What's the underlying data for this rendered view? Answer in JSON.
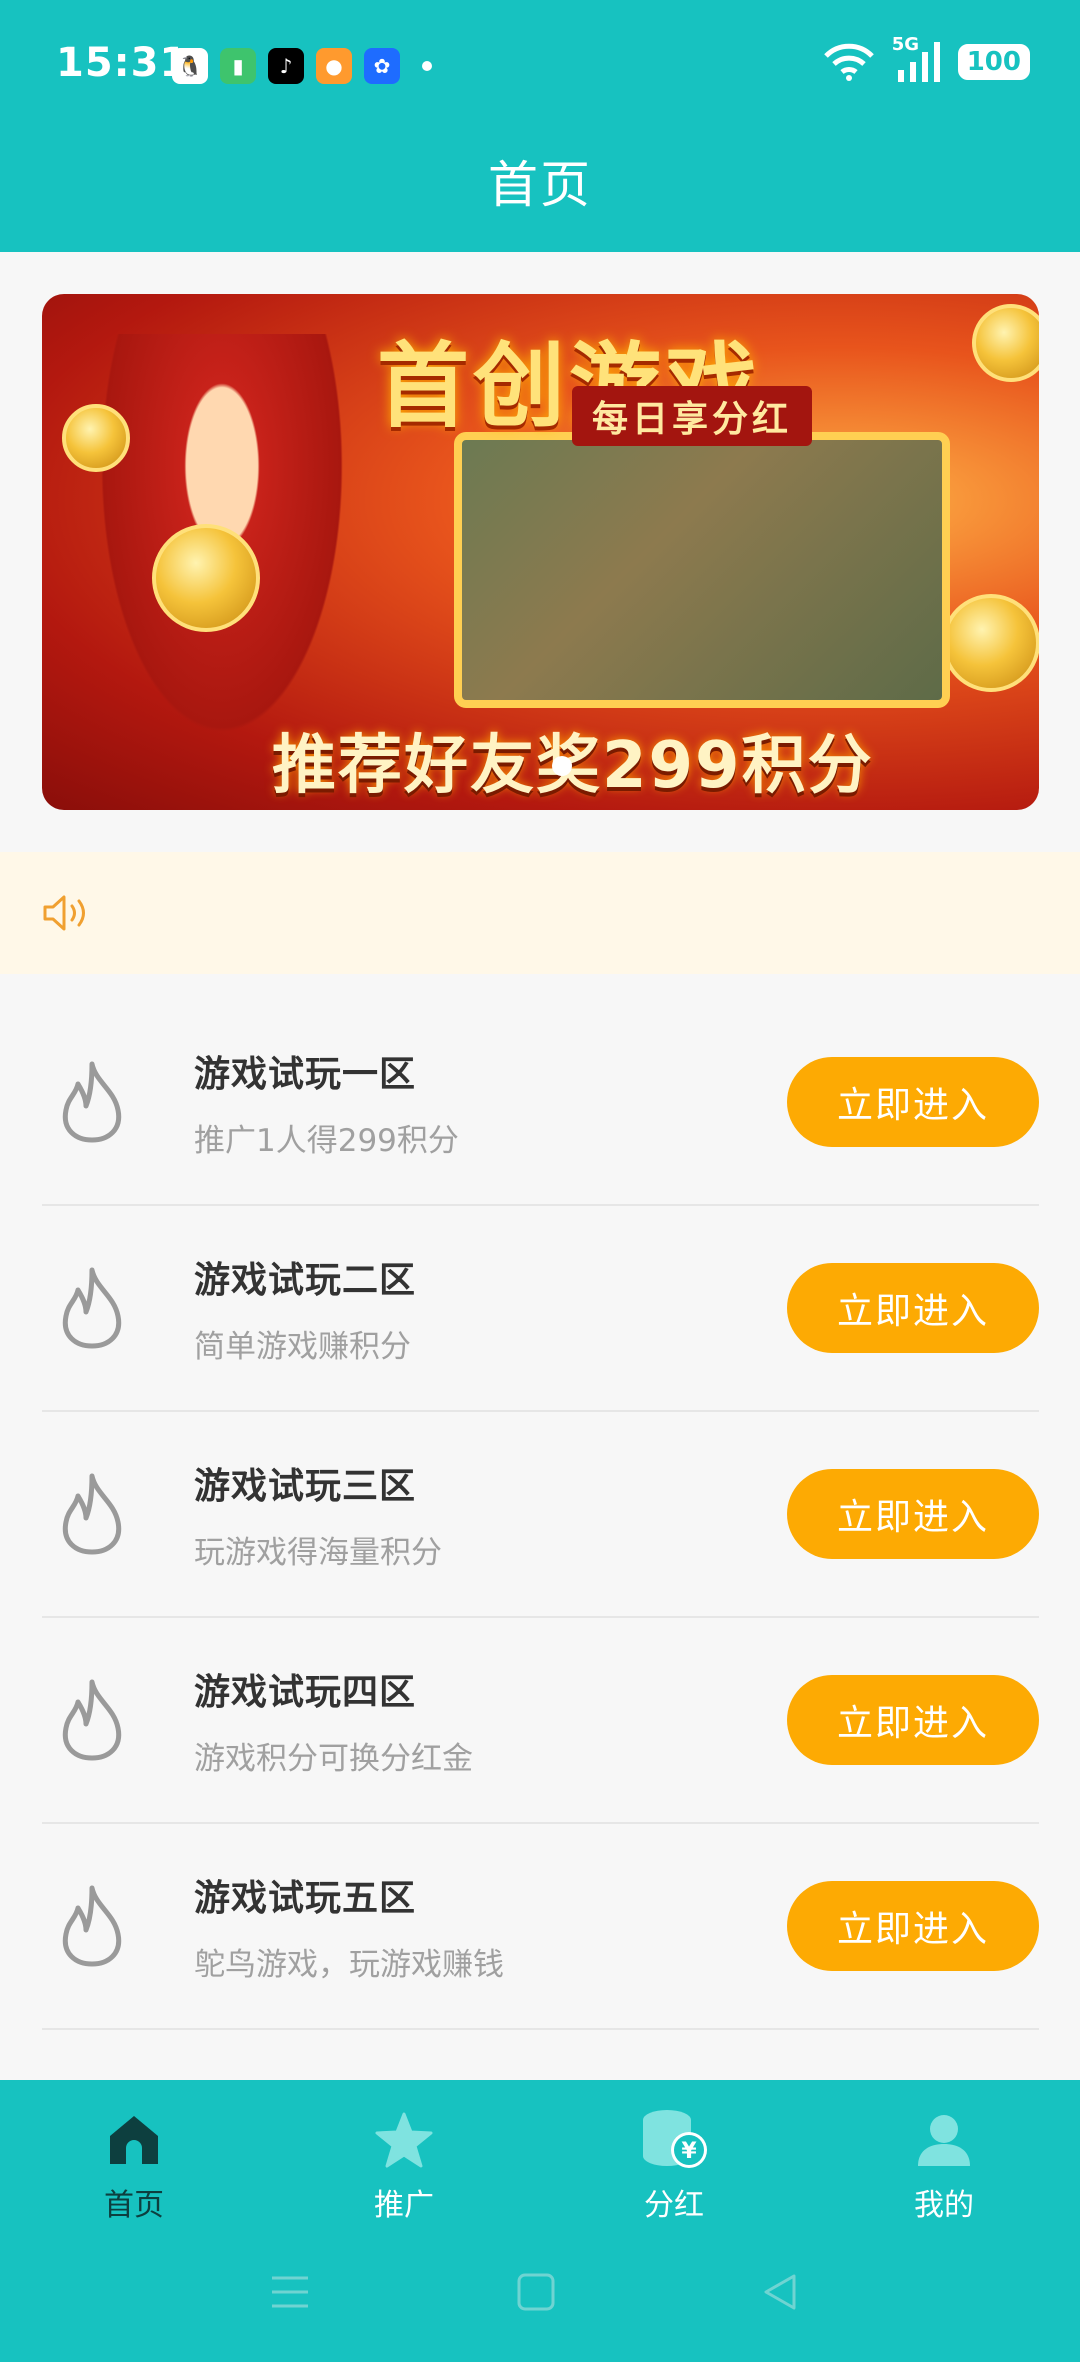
{
  "status_bar": {
    "time": "15:31",
    "network": "5G",
    "battery": "100",
    "app_icons": [
      "qq-icon",
      "battery-app-icon",
      "tiktok-icon",
      "orange-app-icon",
      "blue-app-icon"
    ]
  },
  "header": {
    "title": "首页"
  },
  "banner": {
    "title": "首创游戏",
    "subtitle": "每日享分红",
    "footer": "推荐好友奖299积分"
  },
  "zones": [
    {
      "title": "游戏试玩一区",
      "desc": "推广1人得299积分",
      "button": "立即进入"
    },
    {
      "title": "游戏试玩二区",
      "desc": "简单游戏赚积分",
      "button": "立即进入"
    },
    {
      "title": "游戏试玩三区",
      "desc": "玩游戏得海量积分",
      "button": "立即进入"
    },
    {
      "title": "游戏试玩四区",
      "desc": "游戏积分可换分红金",
      "button": "立即进入"
    },
    {
      "title": "游戏试玩五区",
      "desc": "鸵鸟游戏，玩游戏赚钱",
      "button": "立即进入"
    }
  ],
  "tabbar": {
    "items": [
      {
        "label": "首页",
        "icon": "home-icon",
        "active": true
      },
      {
        "label": "推广",
        "icon": "star-icon",
        "active": false
      },
      {
        "label": "分红",
        "icon": "coins-icon",
        "active": false
      },
      {
        "label": "我的",
        "icon": "user-icon",
        "active": false
      }
    ]
  },
  "colors": {
    "primary": "#17c2c0",
    "button": "#fdaa03",
    "notice_bg": "#fff8e8",
    "active_tab": "#0d3f3f"
  }
}
